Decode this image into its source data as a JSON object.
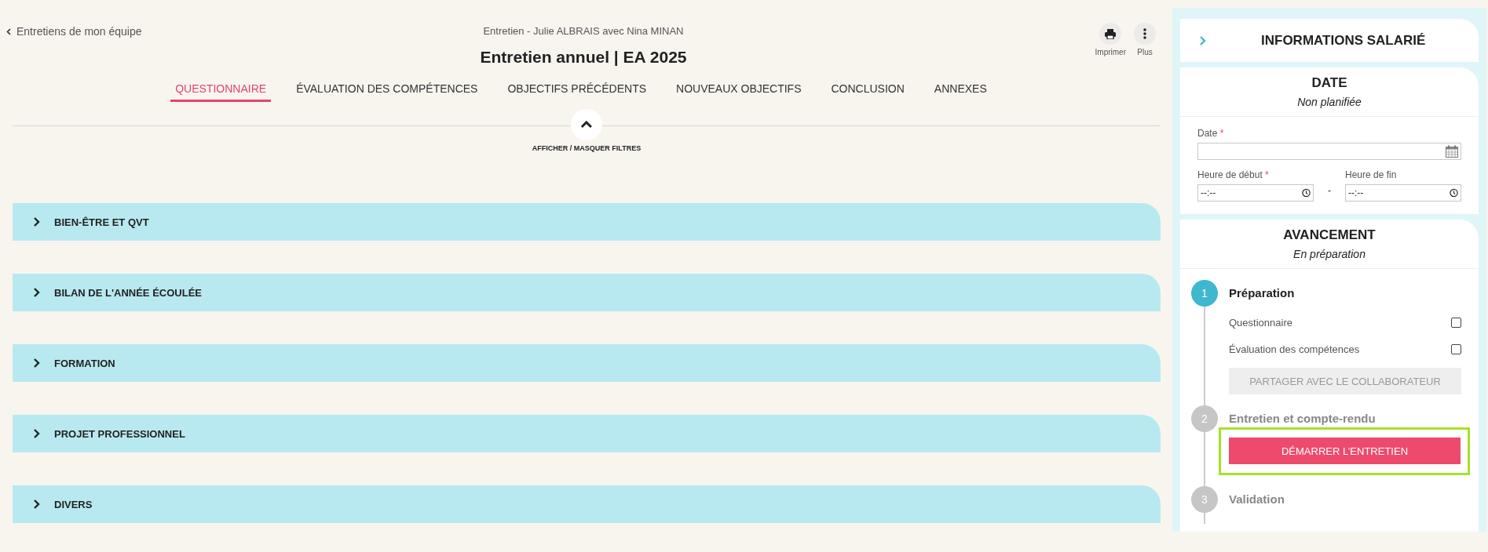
{
  "header": {
    "back_link": "Entretiens de mon équipe",
    "subtitle": "Entretien - Julie ALBRAIS avec Nina MINAN",
    "title": "Entretien annuel | EA 2025",
    "actions": [
      {
        "kind": "print",
        "label": "Imprimer"
      },
      {
        "kind": "more",
        "label": "Plus"
      }
    ]
  },
  "tabs": [
    {
      "label": "QUESTIONNAIRE",
      "selected": true
    },
    {
      "label": "ÉVALUATION DES COMPÉTENCES",
      "selected": false
    },
    {
      "label": "OBJECTIFS PRÉCÉDENTS",
      "selected": false
    },
    {
      "label": "NOUVEAUX OBJECTIFS",
      "selected": false
    },
    {
      "label": "CONCLUSION",
      "selected": false
    },
    {
      "label": "ANNEXES",
      "selected": false
    }
  ],
  "filter_toggle": {
    "label": "AFFICHER / MASQUER FILTRES",
    "expanded": true
  },
  "sections": [
    {
      "title": "BIEN-ÊTRE ET QVT",
      "expanded": false
    },
    {
      "title": "BILAN DE L'ANNÉE ÉCOULÉE",
      "expanded": false
    },
    {
      "title": "FORMATION",
      "expanded": false
    },
    {
      "title": "PROJET PROFESSIONNEL",
      "expanded": false
    },
    {
      "title": "DIVERS",
      "expanded": false
    }
  ],
  "sidebar": {
    "title": "INFORMATIONS SALARIÉ",
    "date_card": {
      "title": "DATE",
      "status": "Non planifiée",
      "date": {
        "label": "Date",
        "required_mark": "*"
      },
      "start": {
        "label": "Heure de début",
        "required_mark": "*",
        "placeholder": "--:--"
      },
      "separator": "-",
      "end": {
        "label": "Heure de fin",
        "placeholder": "--:--"
      }
    },
    "progress": {
      "title": "AVANCEMENT",
      "status": "En préparation",
      "steps": [
        {
          "number": "1",
          "label": "Préparation",
          "active": true,
          "items": [
            {
              "label": "Questionnaire",
              "checked": false
            },
            {
              "label": "Évaluation des compétences",
              "checked": false
            }
          ],
          "button": {
            "label": "PARTAGER AVEC LE COLLABORATEUR",
            "disabled": true
          }
        },
        {
          "number": "2",
          "label": "Entretien et compte-rendu",
          "active": false,
          "button": {
            "label": "DÉMARRER L’ENTRETIEN",
            "disabled": false,
            "highlighted": true
          }
        },
        {
          "number": "3",
          "label": "Validation",
          "active": false
        }
      ]
    }
  }
}
